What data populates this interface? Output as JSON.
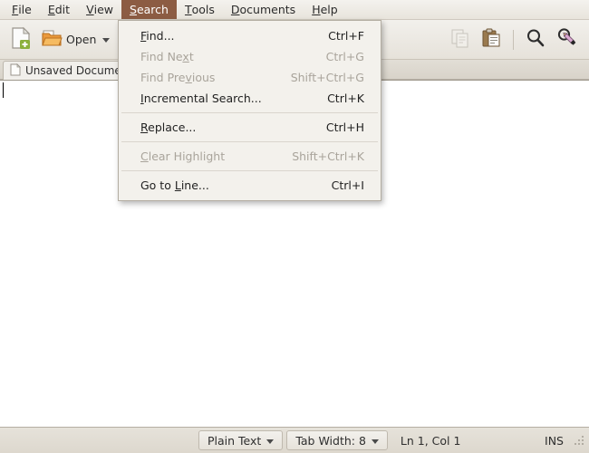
{
  "menubar": {
    "items": [
      {
        "label": "File",
        "mnemonic": "F",
        "active": false
      },
      {
        "label": "Edit",
        "mnemonic": "E",
        "active": false
      },
      {
        "label": "View",
        "mnemonic": "V",
        "active": false
      },
      {
        "label": "Search",
        "mnemonic": "S",
        "active": true
      },
      {
        "label": "Tools",
        "mnemonic": "T",
        "active": false
      },
      {
        "label": "Documents",
        "mnemonic": "D",
        "active": false
      },
      {
        "label": "Help",
        "mnemonic": "H",
        "active": false
      }
    ],
    "active_highlight_color": "#8c5c43"
  },
  "toolbar": {
    "new_icon": "new-document-icon",
    "open_label": "Open",
    "open_icon": "open-folder-icon",
    "open_dropdown_icon": "chevron-down-icon",
    "copy_icon": "copy-icon",
    "copy_enabled": false,
    "paste_icon": "paste-icon",
    "paste_enabled": true,
    "find_icon": "magnifier-icon",
    "replace_icon": "magnifier-pencil-icon"
  },
  "tab": {
    "icon": "document-icon",
    "title": "Unsaved Document 1"
  },
  "editor": {
    "content": "",
    "caret": "text-caret"
  },
  "menu": {
    "title": "Search",
    "items": [
      {
        "label": "Find...",
        "accel": "Ctrl+F",
        "enabled": true,
        "mnemonic_index": 0,
        "type": "item"
      },
      {
        "label": "Find Next",
        "accel": "Ctrl+G",
        "enabled": false,
        "mnemonic_index": 7,
        "type": "item"
      },
      {
        "label": "Find Previous",
        "accel": "Shift+Ctrl+G",
        "enabled": false,
        "mnemonic_index": 8,
        "type": "item"
      },
      {
        "label": "Incremental Search...",
        "accel": "Ctrl+K",
        "enabled": true,
        "mnemonic_index": 0,
        "type": "item"
      },
      {
        "type": "separator"
      },
      {
        "label": "Replace...",
        "accel": "Ctrl+H",
        "enabled": true,
        "mnemonic_index": 0,
        "type": "item"
      },
      {
        "type": "separator"
      },
      {
        "label": "Clear Highlight",
        "accel": "Shift+Ctrl+K",
        "enabled": false,
        "mnemonic_index": 0,
        "type": "item"
      },
      {
        "type": "separator"
      },
      {
        "label": "Go to Line...",
        "accel": "Ctrl+I",
        "enabled": true,
        "mnemonic_index": 6,
        "type": "item"
      }
    ]
  },
  "statusbar": {
    "language": "Plain Text",
    "tab_width": "Tab Width: 8",
    "position": "Ln 1, Col 1",
    "insert_mode": "INS",
    "dropdown_icon": "chevron-down-icon",
    "grip_icon": "resize-grip-icon"
  }
}
